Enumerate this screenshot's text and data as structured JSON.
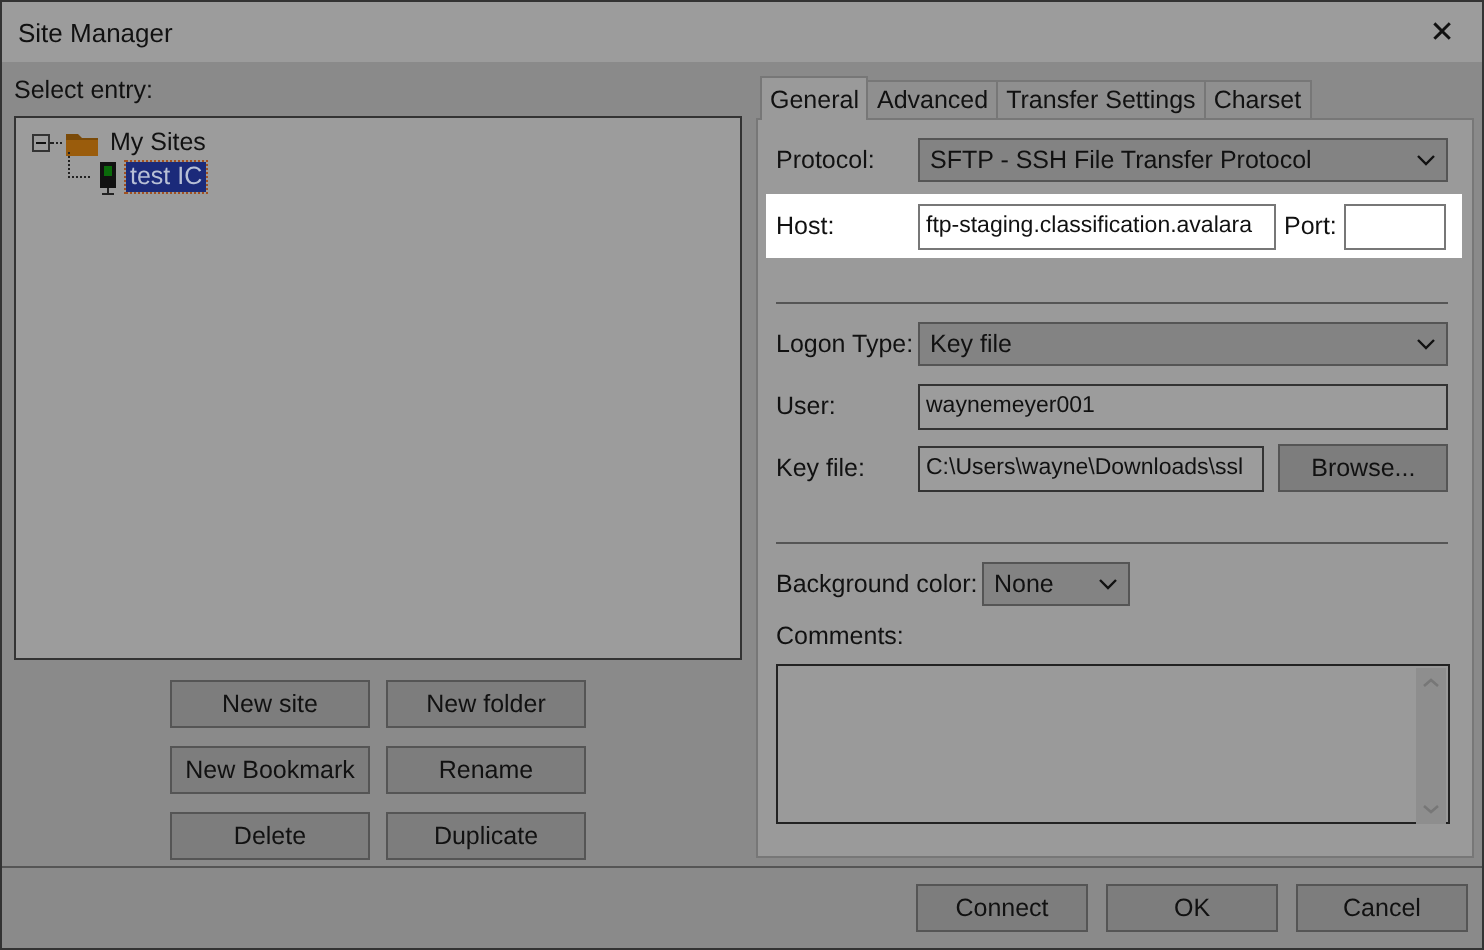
{
  "window": {
    "title": "Site Manager",
    "close": "✕"
  },
  "select_entry": {
    "label": "Select entry:"
  },
  "tree": [
    {
      "label": "My Sites",
      "kind": "folder",
      "expanded": true,
      "selected": false,
      "children": [
        {
          "label": "test IC",
          "kind": "site",
          "selected": true
        }
      ]
    }
  ],
  "site_buttons": [
    "New site",
    "New folder",
    "New Bookmark",
    "Rename",
    "Delete",
    "Duplicate"
  ],
  "tabs": [
    {
      "label": "General",
      "selected": true
    },
    {
      "label": "Advanced",
      "selected": false
    },
    {
      "label": "Transfer Settings",
      "selected": false
    },
    {
      "label": "Charset",
      "selected": false
    }
  ],
  "general": {
    "protocol": {
      "label": "Protocol:",
      "value": "SFTP - SSH File Transfer Protocol"
    },
    "host": {
      "label": "Host:",
      "value": "ftp-staging.classification.avalara",
      "highlighted": true
    },
    "port": {
      "label": "Port:"
    },
    "logon_type": {
      "label": "Logon Type:",
      "value": "Key file"
    },
    "user": {
      "label": "User:",
      "value": "waynemeyer001"
    },
    "key_file": {
      "label": "Key file:",
      "value": "C:\\Users\\wayne\\Downloads\\ssl",
      "button": "Browse..."
    },
    "background_color": {
      "label": "Background color:",
      "value": "None"
    },
    "comments": {
      "label": "Comments:"
    }
  },
  "dialog_buttons": [
    "Connect",
    "OK",
    "Cancel"
  ]
}
